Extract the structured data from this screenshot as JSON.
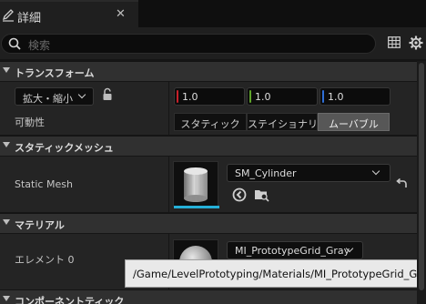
{
  "tab": {
    "title": "詳細",
    "close_glyph": "✕"
  },
  "search": {
    "placeholder": "検索"
  },
  "sections": {
    "transform": "トランスフォーム",
    "static_mesh": "スタティックメッシュ",
    "material": "マテリアル",
    "component_tick": "コンポーネントティック"
  },
  "transform": {
    "mode_label": "拡大・縮小",
    "x": "1.0",
    "y": "1.0",
    "z": "1.0"
  },
  "mobility": {
    "label": "可動性",
    "options": [
      "スタティック",
      "ステイショナリ",
      "ムーバブル"
    ],
    "selected": "ムーバブル"
  },
  "static_mesh": {
    "label": "Static Mesh",
    "value": "SM_Cylinder"
  },
  "material": {
    "label": "エレメント 0",
    "value": "MI_PrototypeGrid_Gray"
  },
  "tooltip": {
    "text": "/Game/LevelPrototyping/Materials/MI_PrototypeGrid_Gray"
  },
  "colors": {
    "x_axis": "#c8202a",
    "y_axis": "#5fa52a",
    "z_axis": "#2f6fd8",
    "accent": "#25b0d8"
  },
  "icons": [
    "pencil-icon",
    "search-icon",
    "table-icon",
    "gear-icon",
    "lock-icon",
    "browse-arrow-icon",
    "find-folder-icon",
    "reset-arrow-icon"
  ]
}
